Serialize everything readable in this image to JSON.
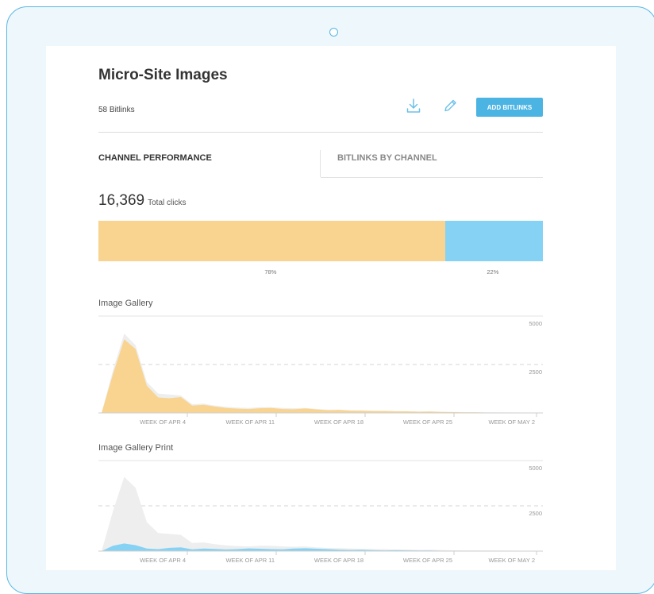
{
  "page": {
    "title": "Micro-Site Images",
    "bitlinks_count": "58 Bitlinks",
    "add_button": "ADD BITLINKS"
  },
  "icons": {
    "download": "download-icon",
    "edit": "pencil-icon",
    "camera": "camera-dot"
  },
  "tabs": [
    {
      "label": "CHANNEL PERFORMANCE",
      "active": true
    },
    {
      "label": "BITLINKS BY CHANNEL",
      "active": false
    }
  ],
  "summary": {
    "total_value": "16,369",
    "total_label": "Total clicks",
    "split": [
      {
        "label": "78%",
        "fraction": 0.78,
        "color": "#f8d490"
      },
      {
        "label": "22%",
        "fraction": 0.22,
        "color": "#86d2f5"
      }
    ]
  },
  "colors": {
    "accent": "#4cb4e2",
    "device_border": "#58b7e4",
    "gallery_fill": "#f8d490",
    "print_fill": "#86d2f5",
    "ghost_fill": "#eeeeee"
  },
  "chart_data": [
    {
      "type": "area",
      "title": "Image Gallery",
      "ylim": [
        0,
        5000
      ],
      "yticks": [
        "5000",
        "2500"
      ],
      "categories": [
        "WEEK OF APR 4",
        "WEEK OF APR 11",
        "WEEK OF APR 18",
        "WEEK OF APR 25",
        "WEEK OF MAY 2"
      ],
      "x": [
        0,
        1,
        2,
        3,
        4,
        5,
        6,
        7,
        8,
        9,
        10,
        11,
        12,
        13,
        14,
        15,
        16,
        17,
        18,
        19,
        20,
        21,
        22,
        23,
        24,
        25,
        26,
        27,
        28,
        29,
        30,
        31,
        32,
        33,
        34,
        35,
        36,
        37,
        38,
        39
      ],
      "series": [
        {
          "values": [
            0,
            2000,
            3800,
            3300,
            1400,
            800,
            760,
            820,
            380,
            420,
            330,
            260,
            220,
            200,
            240,
            260,
            200,
            190,
            230,
            180,
            140,
            150,
            120,
            110,
            100,
            100,
            80,
            80,
            60,
            70,
            50,
            40,
            30,
            30,
            20,
            20,
            20,
            10,
            10,
            10
          ]
        }
      ],
      "background_values": [
        0,
        2200,
        4100,
        3500,
        1600,
        1000,
        950,
        900,
        450,
        480,
        380,
        320,
        280,
        260,
        300,
        300,
        260,
        240,
        260,
        210,
        170,
        170,
        140,
        130,
        120,
        110,
        90,
        90,
        70,
        80,
        60,
        50,
        40,
        40,
        30,
        30,
        25,
        20,
        15,
        10
      ]
    },
    {
      "type": "area",
      "title": "Image Gallery Print",
      "ylim": [
        0,
        5000
      ],
      "yticks": [
        "5000",
        "2500"
      ],
      "categories": [
        "WEEK OF APR 4",
        "WEEK OF APR 11",
        "WEEK OF APR 18",
        "WEEK OF APR 25",
        "WEEK OF MAY 2"
      ],
      "x": [
        0,
        1,
        2,
        3,
        4,
        5,
        6,
        7,
        8,
        9,
        10,
        11,
        12,
        13,
        14,
        15,
        16,
        17,
        18,
        19,
        20,
        21,
        22,
        23,
        24,
        25,
        26,
        27,
        28,
        29,
        30,
        31,
        32,
        33,
        34,
        35,
        36,
        37,
        38,
        39
      ],
      "series": [
        {
          "values": [
            0,
            300,
            420,
            330,
            140,
            110,
            180,
            210,
            100,
            140,
            120,
            90,
            110,
            150,
            130,
            110,
            100,
            140,
            160,
            130,
            110,
            80,
            60,
            70,
            50,
            40,
            50,
            40,
            30,
            30,
            20,
            20,
            20,
            20,
            10,
            10,
            10,
            10,
            5,
            0
          ]
        }
      ],
      "background_values": [
        0,
        2200,
        4100,
        3500,
        1600,
        1000,
        950,
        900,
        450,
        480,
        380,
        320,
        280,
        260,
        300,
        300,
        260,
        240,
        260,
        210,
        170,
        170,
        140,
        130,
        120,
        110,
        90,
        90,
        70,
        80,
        60,
        50,
        40,
        40,
        30,
        30,
        25,
        20,
        15,
        10
      ]
    }
  ]
}
